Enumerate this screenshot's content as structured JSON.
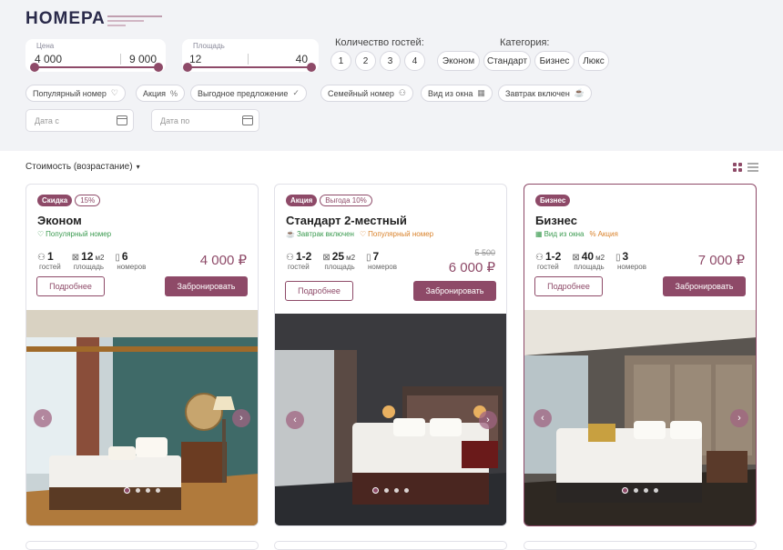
{
  "header": {
    "title": "НОМЕРА"
  },
  "filters": {
    "price": {
      "label": "Цена",
      "min": "4 000",
      "max": "9 000"
    },
    "area": {
      "label": "Площадь",
      "min": "12",
      "max": "40"
    },
    "guests": {
      "label": "Количество гостей:",
      "options": [
        "1",
        "2",
        "3",
        "4"
      ]
    },
    "category": {
      "label": "Категория:",
      "options": [
        "Эконом",
        "Стандарт",
        "Бизнес",
        "Люкс"
      ]
    },
    "chips": [
      {
        "label": "Популярный номер",
        "icon": "heart-icon"
      },
      {
        "label": "Акция",
        "icon": "percent-icon"
      },
      {
        "label": "Выгодное предложение",
        "icon": "check-circle-icon"
      },
      {
        "label": "Семейный номер",
        "icon": "family-icon"
      },
      {
        "label": "Вид из окна",
        "icon": "window-icon"
      },
      {
        "label": "Завтрак включен",
        "icon": "coffee-icon"
      }
    ],
    "date_from": {
      "placeholder": "Дата с"
    },
    "date_to": {
      "placeholder": "Дата по"
    }
  },
  "sort": {
    "label": "Стоимость (возрастание)"
  },
  "cards": [
    {
      "badges": [
        "Скидка",
        "15%"
      ],
      "name": "Эконом",
      "features": [
        {
          "label": "Популярный номер",
          "color": "#3a9a4f",
          "icon": "heart-icon"
        }
      ],
      "specs": [
        {
          "value": "1",
          "unit": "",
          "caption": "гостей",
          "icon": "guests-icon"
        },
        {
          "value": "12",
          "unit": "м2",
          "caption": "площадь",
          "icon": "area-icon"
        },
        {
          "value": "6",
          "unit": "",
          "caption": "номеров",
          "icon": "door-icon"
        }
      ],
      "price": "4 000 ₽",
      "more_label": "Подробнее",
      "book_label": "Забронировать"
    },
    {
      "badges": [
        "Акция",
        "Выгода 10%"
      ],
      "name": "Стандарт 2-местный",
      "features": [
        {
          "label": "Завтрак включен",
          "color": "#3a9a4f",
          "icon": "coffee-icon"
        },
        {
          "label": "Популярный номер",
          "color": "#d9822b",
          "icon": "heart-icon"
        }
      ],
      "specs": [
        {
          "value": "1-2",
          "unit": "",
          "caption": "гостей",
          "icon": "guests-icon"
        },
        {
          "value": "25",
          "unit": "м2",
          "caption": "площадь",
          "icon": "area-icon"
        },
        {
          "value": "7",
          "unit": "",
          "caption": "номеров",
          "icon": "door-icon"
        }
      ],
      "old_price": "5 500",
      "price": "6 000 ₽",
      "more_label": "Подробнее",
      "book_label": "Забронировать"
    },
    {
      "badges": [
        "Бизнес"
      ],
      "name": "Бизнес",
      "features": [
        {
          "label": "Вид из окна",
          "color": "#3a9a4f",
          "icon": "window-icon"
        },
        {
          "label": "Акция",
          "color": "#d9822b",
          "icon": "percent-icon"
        }
      ],
      "specs": [
        {
          "value": "1-2",
          "unit": "",
          "caption": "гостей",
          "icon": "guests-icon"
        },
        {
          "value": "40",
          "unit": "м2",
          "caption": "площадь",
          "icon": "area-icon"
        },
        {
          "value": "3",
          "unit": "",
          "caption": "номеров",
          "icon": "door-icon"
        }
      ],
      "price": "7 000 ₽",
      "more_label": "Подробнее",
      "book_label": "Забронировать"
    }
  ],
  "colors": {
    "accent": "#8e4a68",
    "green": "#3a9a4f",
    "orange": "#d9822b"
  }
}
